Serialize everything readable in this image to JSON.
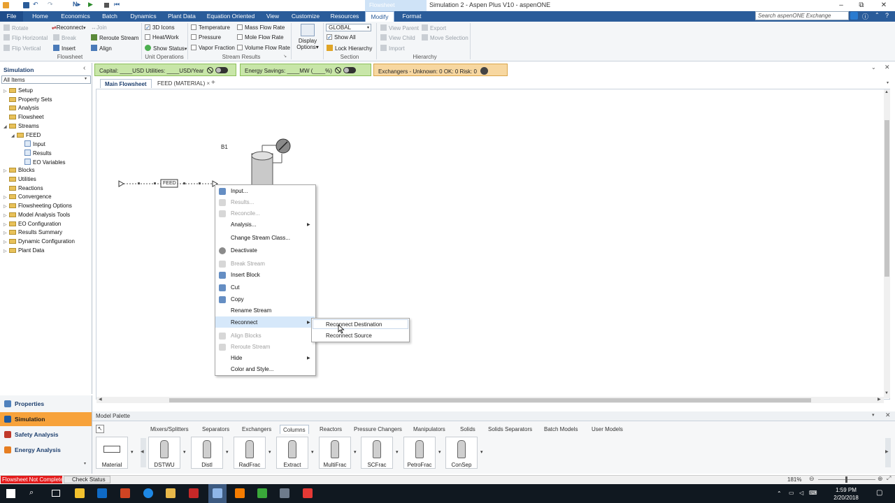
{
  "window": {
    "title": "Simulation 2 - Aspen Plus V10 - aspenONE",
    "context_tab": "Flowsheet",
    "search_placeholder": "Search aspenONE Exchange"
  },
  "menu": [
    "File",
    "Home",
    "Economics",
    "Batch",
    "Dynamics",
    "Plant Data",
    "Equation Oriented",
    "View",
    "Customize",
    "Resources",
    "Modify",
    "Format"
  ],
  "ribbon": {
    "flowsheet": {
      "rotate": "Rotate",
      "flip_horizontal": "Flip Horizontal",
      "flip_vertical": "Flip Vertical",
      "reconnect": "Reconnect",
      "join": "Join",
      "break": "Break",
      "reroute_stream": "Reroute Stream",
      "insert": "Insert",
      "align": "Align",
      "label": "Flowsheet"
    },
    "unit_operations": {
      "icons_3d": "3D Icons",
      "heat_work": "Heat/Work",
      "show_status": "Show Status",
      "label": "Unit Operations"
    },
    "stream_results": {
      "temperature": "Temperature",
      "pressure": "Pressure",
      "vapor_fraction": "Vapor Fraction",
      "mass_flow_rate": "Mass Flow Rate",
      "mole_flow_rate": "Mole Flow Rate",
      "volume_flow_rate": "Volume Flow Rate",
      "label": "Stream Results"
    },
    "display_options": {
      "line1": "Display",
      "line2": "Options"
    },
    "section": {
      "value": "GLOBAL",
      "show_all": "Show All",
      "lock_hierarchy": "Lock Hierarchy",
      "label": "Section"
    },
    "hierarchy": {
      "view_parent": "View Parent",
      "view_child": "View Child",
      "import": "Import",
      "export": "Export",
      "move_selection": "Move Selection",
      "label": "Hierarchy"
    }
  },
  "left_pane": {
    "title": "Simulation",
    "filter": "All Items",
    "tree": [
      {
        "label": "Setup",
        "indent": 0,
        "expanded": false,
        "icon": "folder"
      },
      {
        "label": "Property Sets",
        "indent": 0,
        "expanded": null,
        "icon": "folder"
      },
      {
        "label": "Analysis",
        "indent": 0,
        "expanded": null,
        "icon": "folder"
      },
      {
        "label": "Flowsheet",
        "indent": 0,
        "expanded": null,
        "icon": "folder"
      },
      {
        "label": "Streams",
        "indent": 0,
        "expanded": true,
        "icon": "folder"
      },
      {
        "label": "FEED",
        "indent": 1,
        "expanded": true,
        "icon": "folder"
      },
      {
        "label": "Input",
        "indent": 2,
        "expanded": null,
        "icon": "page"
      },
      {
        "label": "Results",
        "indent": 2,
        "expanded": null,
        "icon": "page"
      },
      {
        "label": "EO Variables",
        "indent": 2,
        "expanded": null,
        "icon": "page"
      },
      {
        "label": "Blocks",
        "indent": 0,
        "expanded": false,
        "icon": "folder"
      },
      {
        "label": "Utilities",
        "indent": 0,
        "expanded": null,
        "icon": "folder"
      },
      {
        "label": "Reactions",
        "indent": 0,
        "expanded": null,
        "icon": "folder"
      },
      {
        "label": "Convergence",
        "indent": 0,
        "expanded": false,
        "icon": "folder"
      },
      {
        "label": "Flowsheeting Options",
        "indent": 0,
        "expanded": false,
        "icon": "folder"
      },
      {
        "label": "Model Analysis Tools",
        "indent": 0,
        "expanded": false,
        "icon": "folder"
      },
      {
        "label": "EO Configuration",
        "indent": 0,
        "expanded": false,
        "icon": "folder"
      },
      {
        "label": "Results Summary",
        "indent": 0,
        "expanded": false,
        "icon": "folder"
      },
      {
        "label": "Dynamic Configuration",
        "indent": 0,
        "expanded": false,
        "icon": "folder"
      },
      {
        "label": "Plant Data",
        "indent": 0,
        "expanded": false,
        "icon": "folder"
      }
    ],
    "nav": [
      "Properties",
      "Simulation",
      "Safety Analysis",
      "Energy Analysis"
    ]
  },
  "control_bar": {
    "capital": "Capital:  ____USD   Utilities:  ____USD/Year",
    "energy": "Energy Savings:  ____MW   (____%)",
    "exchangers": "Exchangers -  Unknown:  0    OK:  0    Risk:  0"
  },
  "doc_tabs": [
    "Main Flowsheet",
    "FEED (MATERIAL)"
  ],
  "canvas": {
    "block_label": "B1",
    "stream_label": "FEED"
  },
  "context_menu": {
    "items": [
      {
        "label": "Input...",
        "enabled": true,
        "arrow": false
      },
      {
        "label": "Results...",
        "enabled": false,
        "arrow": false
      },
      {
        "label": "Reconcile...",
        "enabled": false,
        "arrow": false
      },
      {
        "label": "Analysis...",
        "enabled": true,
        "arrow": true
      },
      {
        "label": "Change Stream Class...",
        "enabled": true,
        "arrow": false
      },
      {
        "label": "Deactivate",
        "enabled": true,
        "arrow": false
      },
      {
        "label": "Break Stream",
        "enabled": false,
        "arrow": false
      },
      {
        "label": "Insert Block",
        "enabled": true,
        "arrow": false
      },
      {
        "label": "Cut",
        "enabled": true,
        "arrow": false
      },
      {
        "label": "Copy",
        "enabled": true,
        "arrow": false
      },
      {
        "label": "Rename Stream",
        "enabled": true,
        "arrow": false
      },
      {
        "label": "Reconnect",
        "enabled": true,
        "arrow": true
      },
      {
        "label": "Align Blocks",
        "enabled": false,
        "arrow": false
      },
      {
        "label": "Reroute Stream",
        "enabled": false,
        "arrow": false
      },
      {
        "label": "Hide",
        "enabled": true,
        "arrow": true
      },
      {
        "label": "Color and Style...",
        "enabled": true,
        "arrow": false
      }
    ],
    "submenu": [
      "Reconnect Destination",
      "Reconnect Source"
    ]
  },
  "palette": {
    "title": "Model Palette",
    "tabs": [
      "Mixers/Splitters",
      "Separators",
      "Exchangers",
      "Columns",
      "Reactors",
      "Pressure Changers",
      "Manipulators",
      "Solids",
      "Solids Separators",
      "Batch Models",
      "User Models"
    ],
    "active_tab": "Columns",
    "items": [
      "Material",
      "DSTWU",
      "Distl",
      "RadFrac",
      "Extract",
      "MultiFrac",
      "SCFrac",
      "PetroFrac",
      "ConSep"
    ]
  },
  "status": {
    "flowsheet_status": "Flowsheet Not Complete",
    "check_status": "Check Status",
    "zoom": "181%"
  },
  "taskbar": {
    "time": "1:59 PM",
    "date": "2/20/2018"
  },
  "colors": {
    "accent": "#2a5c9a",
    "nav_active": "#f7a23b",
    "status_error": "#e41b1b"
  }
}
